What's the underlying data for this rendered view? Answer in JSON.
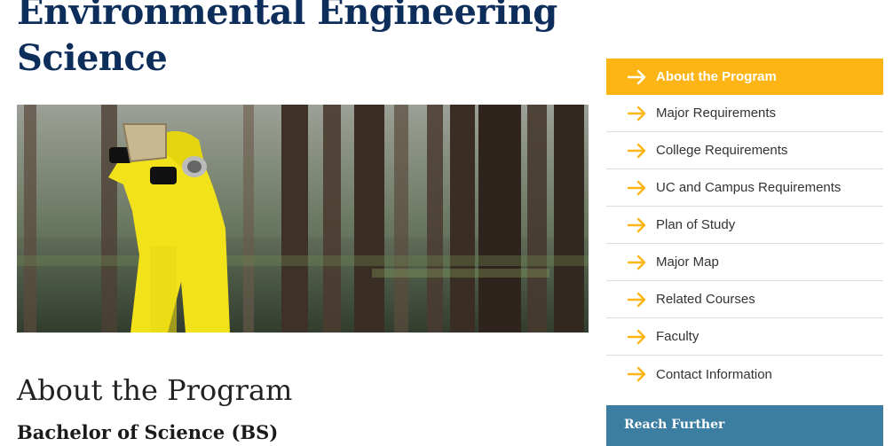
{
  "page": {
    "title": "Environmental Engineering Science"
  },
  "hero_image": {
    "alt": "Person in yellow protective suit inspecting a water sample in a flooded forest"
  },
  "main": {
    "section_heading": "About the Program",
    "degree_heading": "Bachelor of Science (BS)"
  },
  "sidenav": {
    "items": [
      {
        "label": "About the Program",
        "active": true
      },
      {
        "label": "Major Requirements",
        "active": false
      },
      {
        "label": "College Requirements",
        "active": false
      },
      {
        "label": "UC and Campus Requirements",
        "active": false
      },
      {
        "label": "Plan of Study",
        "active": false
      },
      {
        "label": "Major Map",
        "active": false
      },
      {
        "label": "Related Courses",
        "active": false
      },
      {
        "label": "Faculty",
        "active": false
      },
      {
        "label": "Contact Information",
        "active": false
      }
    ]
  },
  "reach_further": {
    "label": "Reach Further"
  },
  "colors": {
    "title_navy": "#0d2d5a",
    "gold_accent": "#fdb515",
    "reach_further_blue": "#3b7ea1",
    "arrow_gold": "#fdb515"
  },
  "icons": {
    "nav_arrow": "arrow-right-icon"
  }
}
